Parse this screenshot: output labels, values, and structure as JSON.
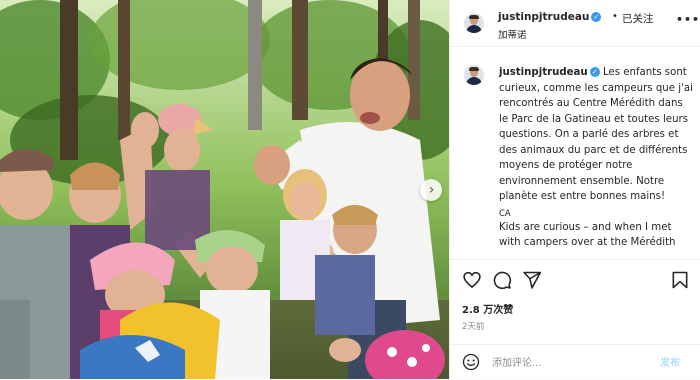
{
  "colors": {
    "accent": "#3897f0",
    "text": "#262626",
    "muted": "#8e8e8e",
    "post_disabled": "#b2dffc"
  },
  "header": {
    "username": "justinpjtrudeau",
    "separator": "•",
    "follow_label": "已关注",
    "location": "加蒂诺",
    "more_icon": "more-horizontal-icon"
  },
  "caption": {
    "username": "justinpjtrudeau",
    "text_fr": "Les enfants sont curieux, comme les campeurs que j'ai rencontrés au Centre Mérédith dans le Parc de la Gatineau et toutes leurs questions. On a parlé des arbres et des animaux du parc et de différents moyens de protéger notre environnement ensemble. Notre planète est entre bonnes mains!",
    "tag": "CA",
    "text_en": "Kids are curious – and when I met with campers over at the Mérédith"
  },
  "actions": {
    "icons": [
      "heart-icon",
      "comment-icon",
      "share-icon",
      "bookmark-icon"
    ]
  },
  "likes": "2.8 万次赞",
  "time": "2天前",
  "comment": {
    "placeholder": "添加评论...",
    "post_label": "发布"
  }
}
